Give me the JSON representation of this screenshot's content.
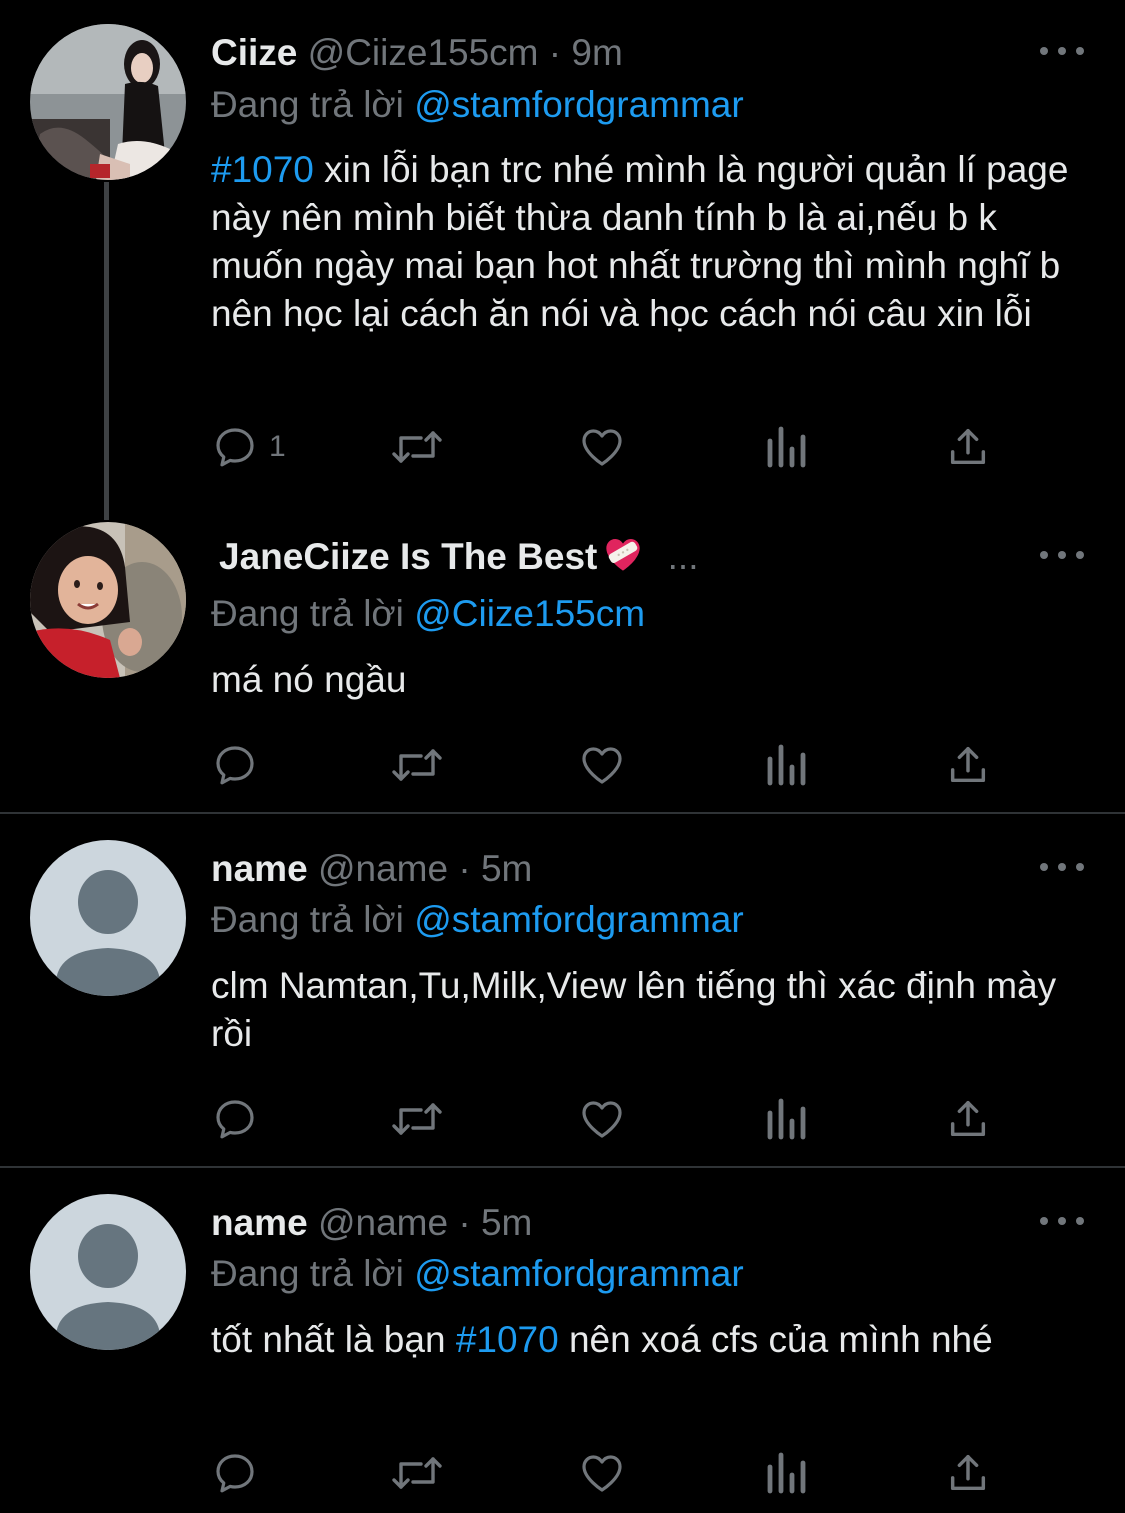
{
  "tweets": [
    {
      "display_name": "Ciize",
      "handle": "@Ciize155cm",
      "dot": "·",
      "time": "9m",
      "replying_prefix": "Đang trả lời",
      "replying_to": "@stamfordgrammar",
      "hashtag": "#1070",
      "text": " xin lỗi bạn trc nhé mình là người quản lí page này nên mình biết thừa danh tính b là ai,nếu b k muốn ngày mai bạn hot nhất trường thì mình nghĩ b nên học lại cách ăn nói và học cách nói câu xin lỗi",
      "reply_count": "1"
    },
    {
      "display_name": "JaneCiize Is The Best",
      "emoji": "heart-with-bandage-icon",
      "ellipsis": "...",
      "replying_prefix": "Đang trả lời",
      "replying_to": "@Ciize155cm",
      "text": "má nó ngầu"
    },
    {
      "display_name": "name",
      "handle": "@name",
      "dot": "·",
      "time": "5m",
      "replying_prefix": "Đang trả lời",
      "replying_to": "@stamfordgrammar",
      "text": "clm Namtan,Tu,Milk,View lên tiếng thì xác định mày rồi"
    },
    {
      "display_name": "name",
      "handle": "@name",
      "dot": "·",
      "time": "5m",
      "replying_prefix": "Đang trả lời",
      "replying_to": "@stamfordgrammar",
      "text_before": "tốt nhất là bạn ",
      "hashtag": "#1070",
      "text_after": " nên xoá cfs của mình nhé"
    }
  ],
  "icons": {
    "reply": "reply-icon",
    "retweet": "retweet-icon",
    "like": "heart-icon",
    "views": "views-icon",
    "share": "share-icon",
    "more": "more-icon"
  },
  "colors": {
    "background": "#000000",
    "text": "#e7e9ea",
    "secondary": "#71767b",
    "link": "#1d9bf0",
    "separator": "#2f3336"
  }
}
